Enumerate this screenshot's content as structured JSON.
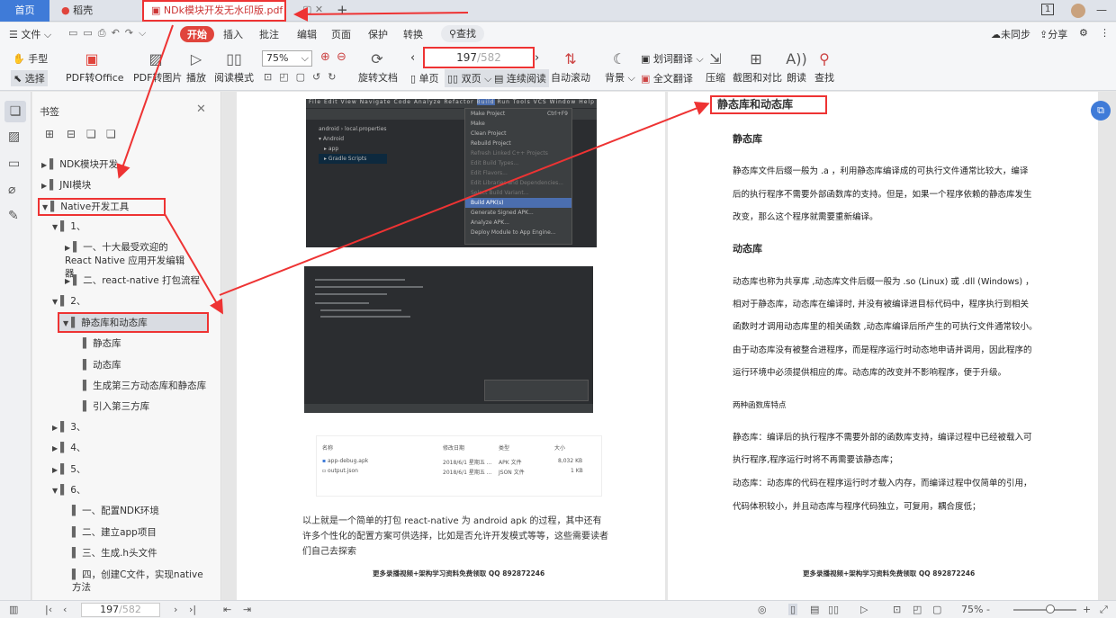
{
  "tabs": {
    "home": "首页",
    "wps": "稻壳",
    "pdf": "NDk模块开发无水印版.pdf"
  },
  "window": {
    "badge": "1"
  },
  "menu": {
    "file": "文件",
    "start": "开始",
    "insert": "插入",
    "annotate": "批注",
    "edit": "编辑",
    "page": "页面",
    "protect": "保护",
    "convert": "转换",
    "search": "查找",
    "sync": "未同步",
    "share": "分享"
  },
  "toolbar": {
    "hand": "手型",
    "select": "选择",
    "pdf_office": "PDF转Office",
    "pdf_img": "PDF转图片",
    "play": "播放",
    "read": "阅读模式",
    "zoom": "75%",
    "rotate": "旋转文档",
    "single": "单页",
    "double": "双页",
    "continuous": "连续阅读",
    "autoscroll": "自动滚动",
    "bg": "背景",
    "word_translate": "划词翻译",
    "full_translate": "全文翻译",
    "compress": "压缩",
    "screenshot": "截图和对比",
    "read_aloud": "朗读",
    "find": "查找",
    "page_current": "197",
    "page_total": "/582"
  },
  "sidebar": {
    "title": "书签",
    "items": [
      {
        "label": "NDK模块开发"
      },
      {
        "label": "JNI模块"
      },
      {
        "label": "Native开发工具"
      },
      {
        "label": "1、"
      },
      {
        "label": "一、十大最受欢迎的 React Native 应用开发编辑器"
      },
      {
        "label": "二、react-native 打包流程"
      },
      {
        "label": "2、"
      },
      {
        "label": "静态库和动态库"
      },
      {
        "label": "静态库"
      },
      {
        "label": "动态库"
      },
      {
        "label": "生成第三方动态库和静态库"
      },
      {
        "label": "引入第三方库"
      },
      {
        "label": "3、"
      },
      {
        "label": "4、"
      },
      {
        "label": "5、"
      },
      {
        "label": "6、"
      },
      {
        "label": "一、配置NDK环境"
      },
      {
        "label": "二、建立app项目"
      },
      {
        "label": "三、生成.h头文件"
      },
      {
        "label": "四，创建C文件，实现native方法"
      }
    ]
  },
  "left_page": {
    "ide_menu": [
      "File",
      "Edit",
      "View",
      "Navigate",
      "Code",
      "Analyze",
      "Refactor",
      "Build",
      "Run",
      "Tools",
      "VCS",
      "Window",
      "Help"
    ],
    "build_menu": [
      "Make Project",
      "Make",
      "Clean Project",
      "Rebuild Project",
      "Refresh Linked C++ Projects",
      "Edit Build Types...",
      "Edit Flavors...",
      "Edit Libraries and Dependencies...",
      "Select Build Variant...",
      "Build APK(s)",
      "Generate Signed APK...",
      "Analyze APK...",
      "Deploy Module to App Engine..."
    ],
    "make_shortcut": "Ctrl+F9",
    "project": [
      "android",
      "local.properties",
      "Android",
      "app",
      "Gradle Scripts"
    ],
    "files_header": [
      "名称",
      "修改日期",
      "类型",
      "大小"
    ],
    "files": [
      {
        "name": "app-debug.apk",
        "date": "2018/6/1 星期五 ...",
        "type": "APK 文件",
        "size": "8,032 KB"
      },
      {
        "name": "output.json",
        "date": "2018/6/1 星期五 ...",
        "type": "JSON 文件",
        "size": "1 KB"
      }
    ],
    "paragraph": "以上就是一个简单的打包 react-native 为 android apk 的过程，其中还有许多个性化的配置方案可供选择，比如是否允许开发模式等等，这些需要读者们自己去探索",
    "footer": "更多录播视频+架构学习资料免费领取 QQ 892872246"
  },
  "right_page": {
    "title": "静态库和动态库",
    "h1": "静态库",
    "p1": [
      "静态库文件后缀一般为 .a ，利用静态库编译成的可执行文件通常比较大，编译",
      "后的执行程序不需要外部函数库的支持。但是，如果一个程序依赖的静态库发生",
      "改变，那么这个程序就需要重新编译。"
    ],
    "h2": "动态库",
    "p2": [
      "动态库也称为共享库 ,动态库文件后缀一般为 .so (Linux) 或 .dll (Windows) ，",
      "相对于静态库，动态库在编译时, 并没有被编译进目标代码中，程序执行到相关",
      "函数时才调用动态库里的相关函数 ,动态库编译后所产生的可执行文件通常较小。",
      "由于动态库没有被整合进程序，而是程序运行时动态地申请并调用，因此程序的",
      "运行环境中必须提供相应的库。动态库的改变并不影响程序，便于升级。"
    ],
    "h3": "两种函数库特点",
    "p3": [
      "静态库：编译后的执行程序不需要外部的函数库支持，编译过程中已经被载入可",
      "执行程序,程序运行时将不再需要该静态库；",
      "动态库：动态库的代码在程序运行时才载入内存，而编译过程中仅简单的引用，",
      "代码体积较小，并且动态库与程序代码独立，可复用，耦合度低；"
    ],
    "footer": "更多录播视频+架构学习资料免费领取 QQ 892872246"
  },
  "status": {
    "page_current": "197",
    "page_total": "/582",
    "zoom": "75% -"
  },
  "colors": {
    "accent": "#3f7bd8",
    "highlight": "#e33333",
    "active_pill": "#e0443c"
  }
}
